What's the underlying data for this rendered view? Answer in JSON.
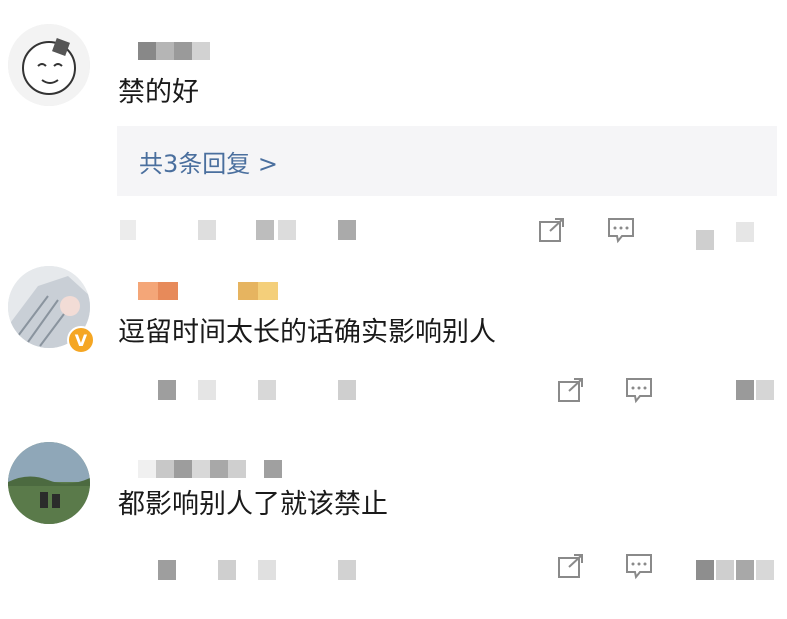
{
  "comments": [
    {
      "text": "禁的好",
      "reply_link": "共3条回复 >",
      "actions": {
        "share_icon": "share-icon",
        "comment_icon": "comment-icon"
      }
    },
    {
      "text": "逗留时间太长的话确实影响别人",
      "badge": "V",
      "actions": {
        "share_icon": "share-icon",
        "comment_icon": "comment-icon"
      }
    },
    {
      "text": "都影响别人了就该禁止",
      "actions": {
        "share_icon": "share-icon",
        "comment_icon": "comment-icon"
      }
    }
  ],
  "colors": {
    "text": "#1a1a1a",
    "link": "#4a6f9e",
    "reply_bg": "#f5f5f7",
    "icon": "#8a8a8a",
    "badge": "#f5a623"
  }
}
